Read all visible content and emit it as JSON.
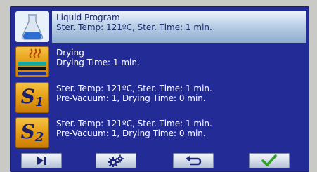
{
  "programs": [
    {
      "icon": "liquid-flask-icon",
      "title": "Liquid Program",
      "detail": "Ster. Temp: 121ºC, Ster. Time: 1 min.",
      "selected": true
    },
    {
      "icon": "drying-icon",
      "title": "Drying",
      "detail": "Drying Time: 1 min.",
      "selected": false
    },
    {
      "icon": "s1-icon",
      "icon_text": "S",
      "icon_sub": "1",
      "line1": "Ster. Temp: 121ºC, Ster. Time: 1 min.",
      "line2": "Pre-Vacuum: 1, Drying Time: 0 min.",
      "selected": false
    },
    {
      "icon": "s2-icon",
      "icon_text": "S",
      "icon_sub": "2",
      "line1": "Ster. Temp: 121ºC, Ster. Time: 1 min.",
      "line2": "Pre-Vacuum: 1, Drying Time: 0 min.",
      "selected": false
    }
  ],
  "toolbar": [
    {
      "icon": "skip-next-icon"
    },
    {
      "icon": "settings-gears-icon"
    },
    {
      "icon": "return-icon"
    },
    {
      "icon": "checkmark-icon"
    }
  ],
  "colors": {
    "screen_bg": "#232b97",
    "icon_tile": "#e8a21a",
    "selected_highlight": "#c7d8ee",
    "check_green": "#2fa12a"
  }
}
